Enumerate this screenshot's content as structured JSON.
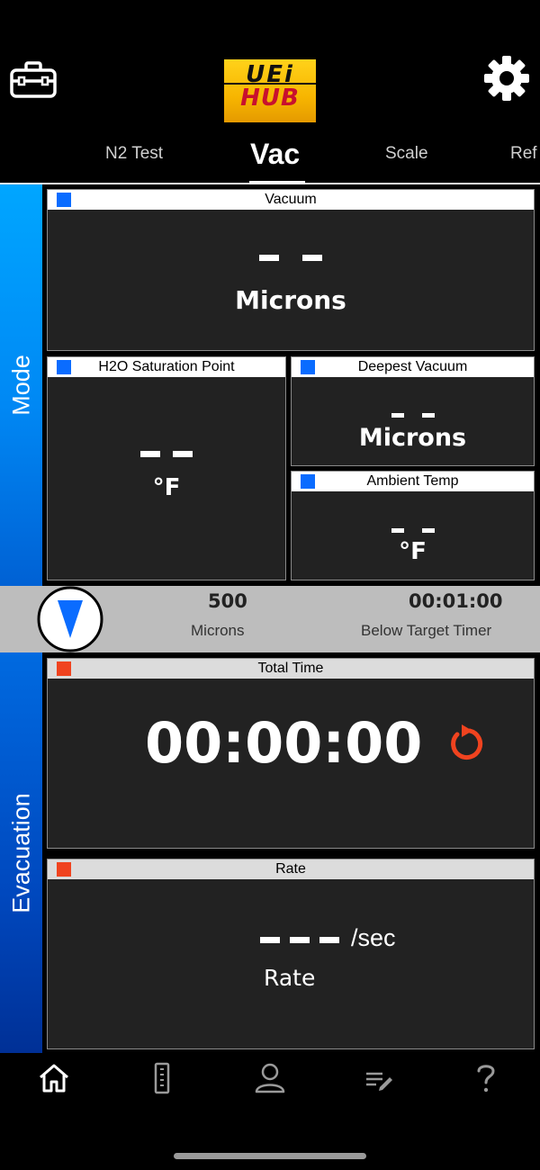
{
  "header": {
    "logo_top": "UEi",
    "logo_bottom": "HUB",
    "tabs": [
      {
        "label": "N2 Test"
      },
      {
        "label": "Vac"
      },
      {
        "label": "Scale"
      },
      {
        "label": "Ref"
      }
    ],
    "active_tab": "Vac"
  },
  "sidebar": {
    "mode_label": "Mode",
    "evacuation_label": "Evacuation"
  },
  "panels": {
    "vacuum": {
      "title": "Vacuum",
      "value": "– –",
      "unit": "Microns"
    },
    "h2o": {
      "title": "H2O Saturation Point",
      "value": "– –",
      "unit": "°F"
    },
    "deepest": {
      "title": "Deepest Vacuum",
      "value": "– –",
      "unit": "Microns"
    },
    "ambient": {
      "title": "Ambient Temp",
      "value": "– –",
      "unit": "°F"
    },
    "total_time": {
      "title": "Total Time",
      "value": "00:00:00"
    },
    "rate": {
      "title": "Rate",
      "value": "– – –",
      "per": "/sec",
      "unit": "Rate"
    }
  },
  "target": {
    "microns_value": "500",
    "microns_label": "Microns",
    "timer_value": "00:01:00",
    "timer_label": "Below Target Timer"
  },
  "colors": {
    "mode_accent": "#0a6cff",
    "evac_accent": "#f0431f",
    "reset_icon": "#f0431f"
  },
  "bottom_nav": [
    "home-icon",
    "ruler-icon",
    "profile-icon",
    "notes-icon",
    "help-icon"
  ]
}
